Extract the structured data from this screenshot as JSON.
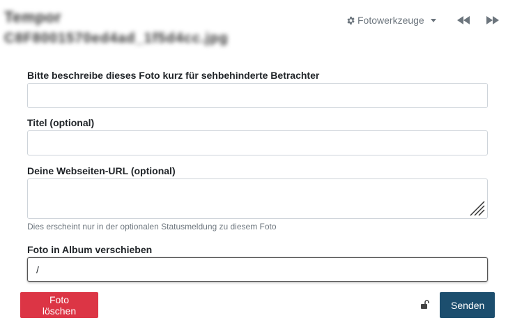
{
  "header": {
    "blurred_title_line1": "Tempor",
    "blurred_title_line2": "C8F8001570ed4ad_1f5d4cc.jpg"
  },
  "toolbar": {
    "tools_label": "Fotowerkzeuge",
    "tools_icon": "gear-icon",
    "prev_icon": "rewind-icon",
    "next_icon": "fast-forward-icon"
  },
  "form": {
    "alt_text": {
      "label": "Bitte beschreibe dieses Foto kurz für sehbehinderte Betrachter",
      "value": ""
    },
    "title": {
      "label": "Titel (optional)",
      "value": ""
    },
    "website": {
      "label": "Deine Webseiten-URL (optional)",
      "value": "",
      "help": "Dies erscheint nur in der optionalen Statusmeldung zu diesem Foto"
    },
    "album": {
      "label": "Foto in Album verschieben",
      "value": "/"
    }
  },
  "actions": {
    "delete_label": "Foto löschen",
    "send_label": "Senden",
    "lock_icon": "unlock-icon"
  },
  "colors": {
    "delete": "#dc3545",
    "send": "#1c4e6e",
    "muted": "#6c757d"
  }
}
